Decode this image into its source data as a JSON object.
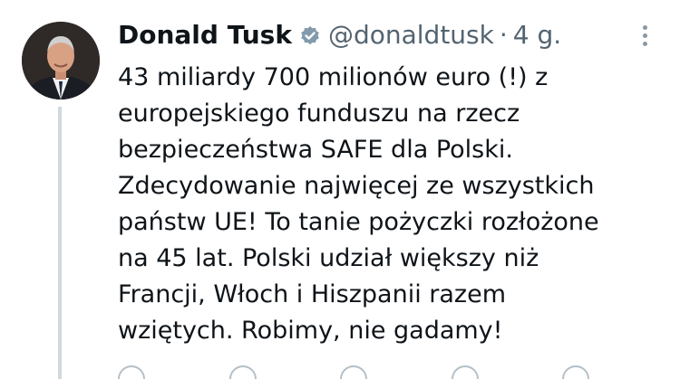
{
  "author": {
    "name": "Donald Tusk",
    "handle": "@donaldtusk",
    "separator": "·",
    "time": "4 g."
  },
  "post": {
    "lines": [
      "43 miliardy 700 milionów euro (!) z",
      "europejskiego funduszu na rzecz",
      "bezpieczeństwa SAFE dla Polski.",
      "Zdecydowanie najwięcej ze wszystkich",
      "państw UE! To tanie pożyczki rozłożone",
      "na 45 lat. Polski udział większy niż",
      "Francji, Włoch i Hiszpanii razem",
      "wziętych. Robimy, nie gadamy!"
    ]
  },
  "icons": {
    "verified": "verified-badge-icon",
    "more": "more-options-icon",
    "reply": "reply-icon",
    "repost": "repost-icon",
    "like": "like-icon",
    "views": "views-icon",
    "share": "share-icon"
  },
  "colors": {
    "text": "#0f1419",
    "muted": "#536471",
    "thread_line": "#cfd9de",
    "verified_badge": "#829aab"
  }
}
